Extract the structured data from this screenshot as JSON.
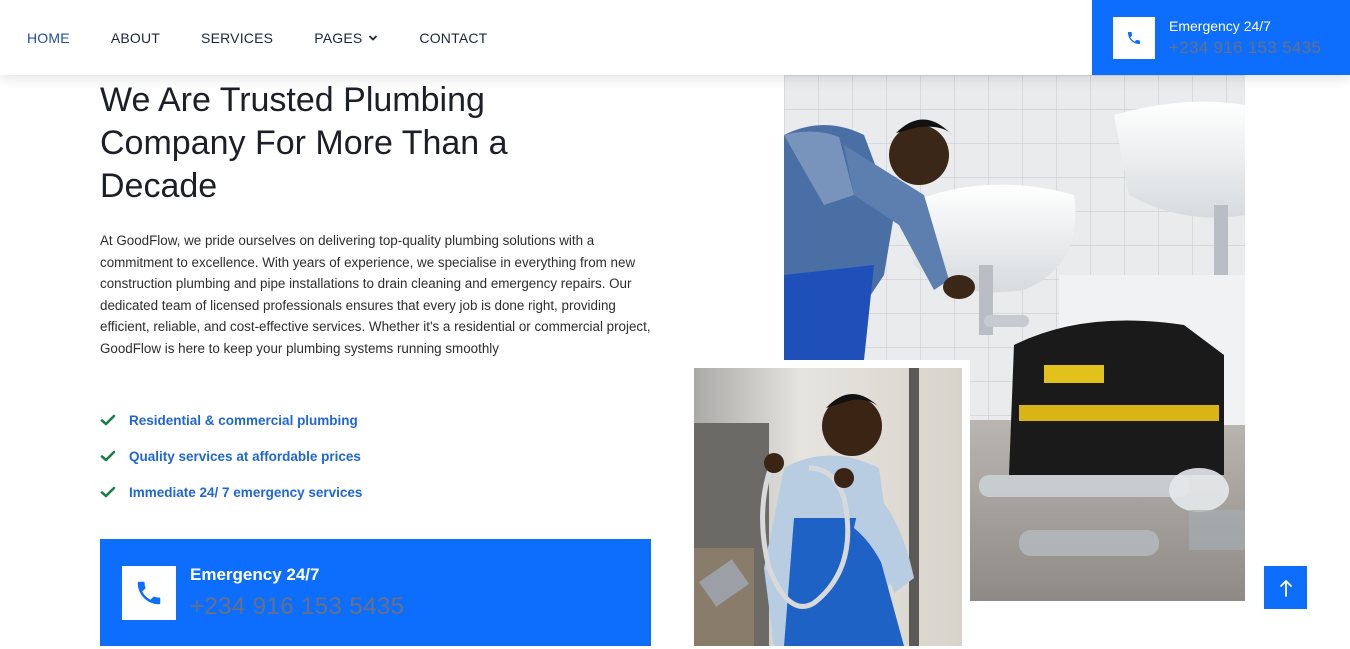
{
  "nav": {
    "items": [
      {
        "label": "HOME"
      },
      {
        "label": "ABOUT"
      },
      {
        "label": "SERVICES"
      },
      {
        "label": "PAGES"
      },
      {
        "label": "CONTACT"
      }
    ]
  },
  "header_emergency": {
    "label": "Emergency 24/7",
    "phone": "+234 916 153 5435",
    "icon": "phone-icon"
  },
  "main": {
    "title": "We Are Trusted Plumbing Company For More Than a Decade",
    "paragraph": "At GoodFlow, we pride ourselves on delivering top-quality plumbing solutions with a commitment to excellence. With years of experience, we specialise in everything from new construction plumbing and pipe installations to drain cleaning and emergency repairs. Our dedicated team of licensed professionals ensures that every job is done right, providing efficient, reliable, and cost-effective services. Whether it's a residential or commercial project, GoodFlow is here to keep your plumbing systems running smoothly",
    "features": [
      {
        "label": "Residential & commercial plumbing"
      },
      {
        "label": "Quality services at affordable prices"
      },
      {
        "label": "Immediate 24/ 7 emergency services"
      }
    ]
  },
  "emergency_box": {
    "label": "Emergency 24/7",
    "phone": "+234 916 153 5435",
    "icon": "phone-icon"
  },
  "colors": {
    "accent": "#0d6efd",
    "check": "#1e7e4a",
    "feature_text": "#1f66d6",
    "phone_text": "#6b6f80"
  }
}
